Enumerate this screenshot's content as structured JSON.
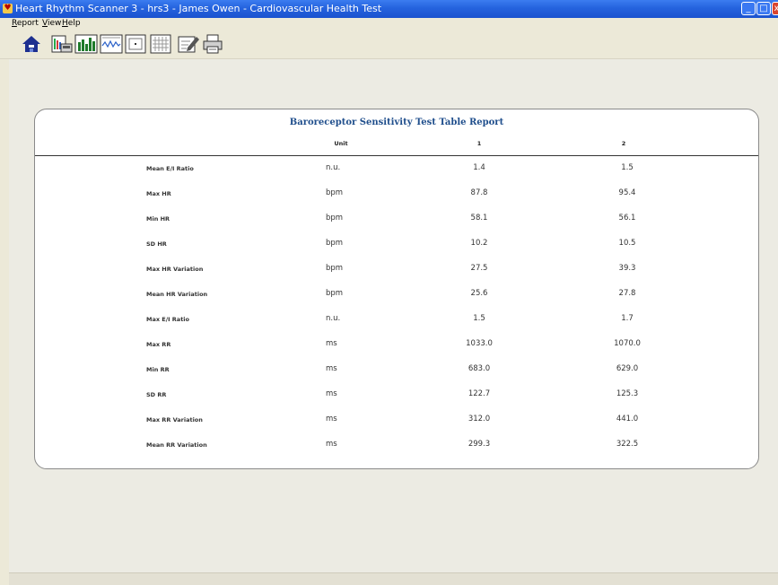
{
  "window": {
    "title": "Heart Rhythm Scanner 3 - hrs3 - James Owen - Cardiovascular Health Test",
    "controls": [
      "minimize",
      "maximize",
      "close"
    ]
  },
  "menu": [
    "Report",
    "View",
    "Help"
  ],
  "toolbar": [
    {
      "name": "home-icon"
    },
    {
      "name": "report-list-icon"
    },
    {
      "name": "bar-chart-icon"
    },
    {
      "name": "waveform-icon"
    },
    {
      "name": "single-frame-icon"
    },
    {
      "name": "grid-table-icon"
    },
    {
      "name": "notes-edit-icon"
    },
    {
      "name": "print-icon"
    }
  ],
  "report": {
    "title": "Baroreceptor Sensitivity Test Table Report",
    "headers": {
      "unit": "Unit",
      "col1": "1",
      "col2": "2"
    },
    "rows": [
      {
        "label": "Mean E/I Ratio",
        "unit": "n.u.",
        "v1": "1.4",
        "v2": "1.5"
      },
      {
        "label": "Max HR",
        "unit": "bpm",
        "v1": "87.8",
        "v2": "95.4"
      },
      {
        "label": "Min HR",
        "unit": "bpm",
        "v1": "58.1",
        "v2": "56.1"
      },
      {
        "label": "SD HR",
        "unit": "bpm",
        "v1": "10.2",
        "v2": "10.5"
      },
      {
        "label": "Max HR Variation",
        "unit": "bpm",
        "v1": "27.5",
        "v2": "39.3"
      },
      {
        "label": "Mean HR Variation",
        "unit": "bpm",
        "v1": "25.6",
        "v2": "27.8"
      },
      {
        "label": "Max E/I Ratio",
        "unit": "n.u.",
        "v1": "1.5",
        "v2": "1.7"
      },
      {
        "label": "Max RR",
        "unit": "ms",
        "v1": "1033.0",
        "v2": "1070.0"
      },
      {
        "label": "Min RR",
        "unit": "ms",
        "v1": "683.0",
        "v2": "629.0"
      },
      {
        "label": "SD RR",
        "unit": "ms",
        "v1": "122.7",
        "v2": "125.3"
      },
      {
        "label": "Max RR Variation",
        "unit": "ms",
        "v1": "312.0",
        "v2": "441.0"
      },
      {
        "label": "Mean RR Variation",
        "unit": "ms",
        "v1": "299.3",
        "v2": "322.5"
      }
    ]
  }
}
